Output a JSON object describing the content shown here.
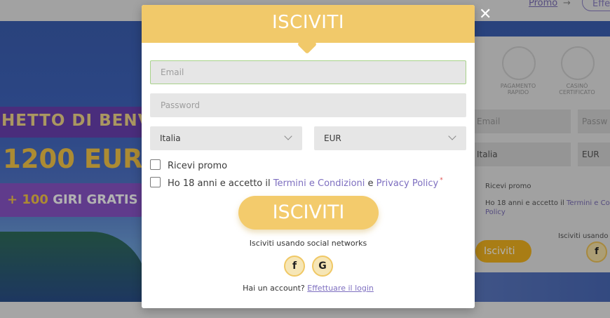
{
  "background": {
    "top_bar": {
      "promo_link": "Promo",
      "arrow": "→",
      "login_button": "Effe"
    },
    "hero": {
      "promo_line1": "HETTO DI BENVE",
      "promo_line2": "1200 EUR",
      "promo_line3_prefix": "+ 100",
      "promo_line3_suffix": " GIRI GRATIS"
    },
    "panel": {
      "badge1": "PAGAMENTO RAPIDO",
      "badge2": "CASINÒ CERTIFICATO",
      "email_placeholder": "Email",
      "password_placeholder": "Passw",
      "country": "Italia",
      "currency": "EUR",
      "promo_check": "Ricevi promo",
      "terms_prefix": "Ho 18 anni e accetto il ",
      "terms_link": "Termini e Con",
      "terms_link2": "Policy",
      "submit": "Isciviti",
      "social_label": "Isciviti usando",
      "fb": "f"
    }
  },
  "modal": {
    "title": "ISCIVITI",
    "close": "✕",
    "email_placeholder": "Email",
    "password_placeholder": "Password",
    "country_value": "Italia",
    "currency_value": "EUR",
    "promo_label": "Ricevi promo",
    "terms_prefix": "Ho 18 anni e accetto il ",
    "terms_link": "Termini e Condizioni",
    "terms_and": " e ",
    "privacy_link": "Privacy Policy",
    "required_mark": "*",
    "submit_label": "ISCIVITI",
    "social_label": "Isciviti usando social networks",
    "facebook_glyph": "f",
    "google_glyph": "G",
    "account_prompt": "Hai un account? ",
    "login_link": "Effettuare il login"
  },
  "colors": {
    "header": "#f1c96a",
    "submit": "#f3cb6c",
    "link": "#7e6fc0",
    "email_focus_border": "#a8d28a"
  }
}
